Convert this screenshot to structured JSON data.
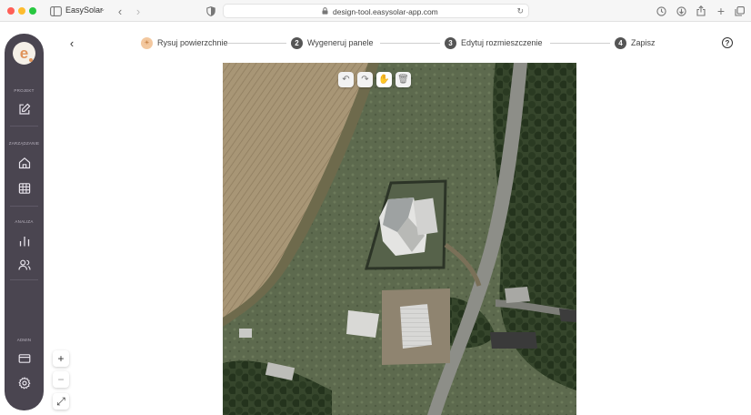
{
  "browser": {
    "app_name": "EasySolar",
    "url": "design-tool.easysolar-app.com"
  },
  "sidebar": {
    "logo_letter": "e",
    "sections": [
      {
        "label": "PROJEKT"
      },
      {
        "label": "ZARZĄDZANIE"
      },
      {
        "label": "ANALIZA"
      },
      {
        "label": "ADMIN"
      }
    ],
    "items": [
      {
        "icon": "edit-icon"
      },
      {
        "icon": "home-icon"
      },
      {
        "icon": "solar-panel-icon"
      },
      {
        "icon": "bar-chart-icon"
      },
      {
        "icon": "users-icon"
      },
      {
        "icon": "credit-card-icon"
      },
      {
        "icon": "gear-icon"
      }
    ]
  },
  "stepper": {
    "steps": [
      {
        "number": "",
        "label": "Rysuj powierzchnie",
        "active": true
      },
      {
        "number": "2",
        "label": "Wygeneruj panele",
        "active": false
      },
      {
        "number": "3",
        "label": "Edytuj rozmieszczenie",
        "active": false
      },
      {
        "number": "4",
        "label": "Zapisz",
        "active": false
      }
    ],
    "help_symbol": "?"
  },
  "map_tools": {
    "undo": "↶",
    "redo": "↷",
    "pan": "✋",
    "delete": "🗑"
  },
  "zoom": {
    "plus": "+",
    "minus": "−",
    "fit": "⤢"
  },
  "colors": {
    "sidebar_bg": "#4a4550",
    "accent": "#e0935a",
    "active_step_bg": "#f3c89f"
  }
}
